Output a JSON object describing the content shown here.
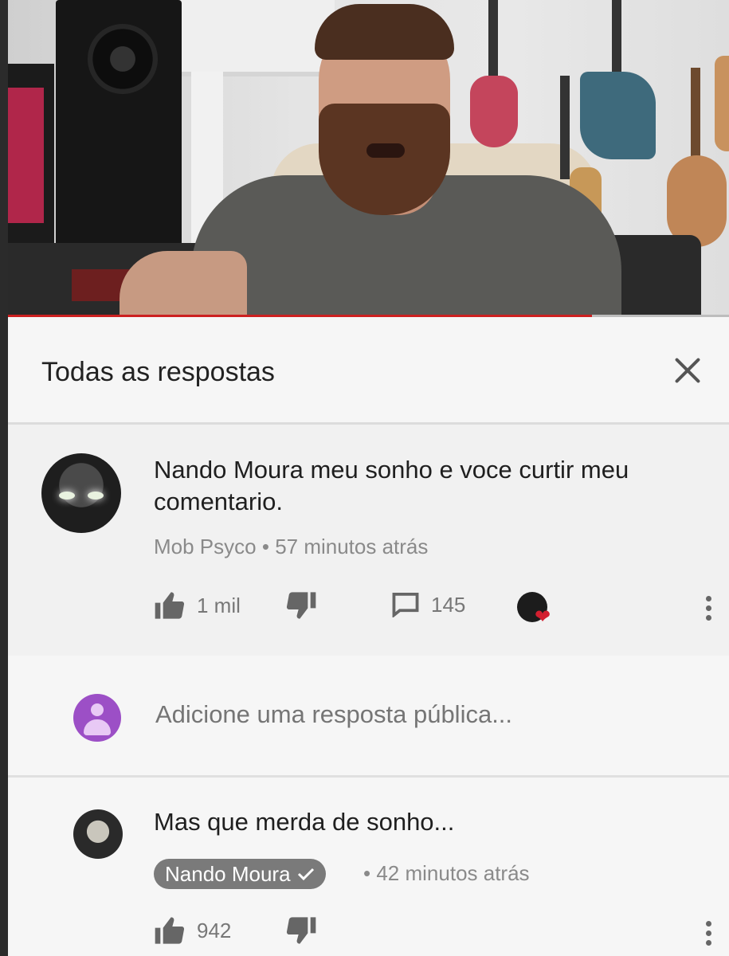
{
  "video": {
    "progress_fraction": 0.81
  },
  "panel": {
    "title": "Todas as respostas",
    "close_icon": "close-icon"
  },
  "comment": {
    "text": "Nando Moura meu sonho e voce curtir meu comentario.",
    "author": "Mob Psyco",
    "separator": "•",
    "time": "57 minutos atrás",
    "likes": "1 mil",
    "replies": "145",
    "icons": [
      "thumbs-up-icon",
      "thumbs-down-icon",
      "reply-icon",
      "creator-heart-icon",
      "more-vert-icon"
    ],
    "heart_color": "#d21f2f"
  },
  "reply_box": {
    "placeholder": "Adicione uma resposta pública...",
    "avatar_color": "#9c4fc6"
  },
  "reply": {
    "text": "Mas que merda de sonho...",
    "author": "Nando Moura",
    "verified_icon": "checkmark-icon",
    "separator": "•",
    "time": "42 minutos atrás",
    "likes": "942"
  }
}
